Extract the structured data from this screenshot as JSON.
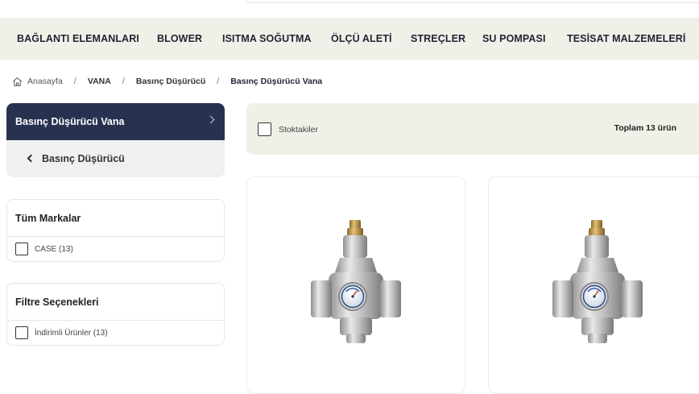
{
  "nav": {
    "items": [
      "BAĞLANTI ELEMANLARI",
      "BLOWER",
      "ISITMA SOĞUTMA",
      "ÖLÇÜ ALETİ",
      "STREÇLER",
      "SU POMPASI",
      "TESİSAT MALZEMELERİ"
    ]
  },
  "breadcrumb": {
    "home": "Anasayfa",
    "level1": "VANA",
    "level2": "Basınç Düşürücü",
    "current": "Basınç Düşürücü Vana",
    "separator": "/"
  },
  "category": {
    "title": "Basınç Düşürücü Vana",
    "back_label": "Basınç Düşürücü"
  },
  "brands": {
    "title": "Tüm Markalar",
    "options": [
      "CASE (13)"
    ]
  },
  "filters": {
    "title": "Filtre Seçenekleri",
    "options": [
      "İndirimli Ürünler (13)"
    ]
  },
  "toolbar": {
    "stock_label": "Stoktakiler",
    "total_label": "Toplam 13 ürün"
  },
  "products": [
    {
      "image": "pressure-reducing-valve"
    },
    {
      "image": "pressure-reducing-valve"
    }
  ],
  "colors": {
    "nav_bg": "#f1f0e8",
    "category_header": "#283250",
    "category_bg": "#f0f0f0",
    "text_dark": "#1f2433"
  }
}
